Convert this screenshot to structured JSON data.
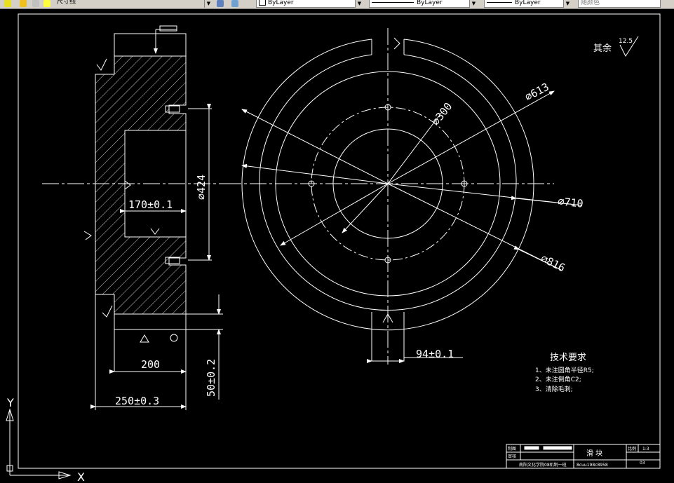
{
  "toolbar": {
    "layer_name": "尺寸线",
    "color_control": "ByLayer",
    "linetype_control": "ByLayer",
    "lineweight_control": "ByLayer",
    "plotstyle_control": "随颜色"
  },
  "drawing": {
    "surface_note_label": "其余",
    "surface_note_value": "12.5",
    "side_view": {
      "dim_inner_height": "170±0.1",
      "dim_bore": "⌀424",
      "dim_width_200": "200",
      "dim_width_250": "250±0.3",
      "dim_height_50": "50±0.2"
    },
    "front_view": {
      "dim_d613": "⌀613",
      "dim_d300": "⌀300",
      "dim_d710": "⌀710",
      "dim_d816": "⌀816",
      "dim_slot_94": "94±0.1"
    },
    "tech_requirements": {
      "title": "技术要求",
      "items": [
        "1、未注圆角半径R5;",
        "2、未注倒角C2;",
        "3、清除毛刺;"
      ]
    },
    "title_block": {
      "drawn_label": "制图",
      "checked_label": "审核",
      "part_name": "滑 块",
      "scale_label": "比例",
      "scale_value": "1:3",
      "sheet_no": "03",
      "school": "南阳文化学院08机制一班",
      "file_code": "8cuu198c8958"
    },
    "ucs": {
      "x_label": "X",
      "y_label": "Y"
    }
  }
}
